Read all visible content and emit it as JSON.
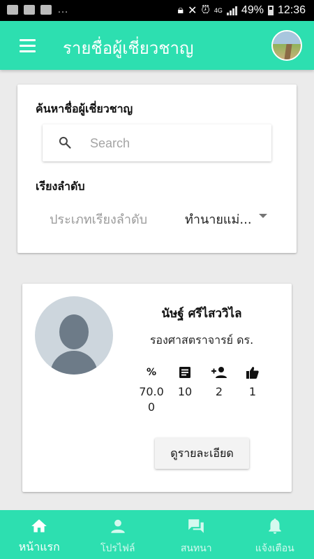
{
  "status_bar": {
    "battery": "49%",
    "time": "12:36",
    "network": "4G"
  },
  "app_bar": {
    "title": "รายชื่อผู้เชี่ยวชาญ",
    "menu_icon": "menu-icon",
    "avatar_icon": "user-photo"
  },
  "search_section": {
    "label": "ค้นหาชื่อผู้เชี่ยวชาญ",
    "search_icon": "search-icon",
    "search_placeholder": "Search",
    "search_value": ""
  },
  "sort_section": {
    "label": "เรียงลำดับ",
    "placeholder": "ประเภทเรียงลำดับ",
    "selected": "ทำนายแม่...",
    "dropdown_icon": "caret-down-icon"
  },
  "expert": {
    "name": "นัษฐ์ ศรีไสววิไล",
    "title": "รองศาสตราจารย์ ดร.",
    "stats": [
      {
        "icon": "percent-icon",
        "symbol": "%",
        "value": "70.00"
      },
      {
        "icon": "article-icon",
        "value": "10"
      },
      {
        "icon": "person-add-icon",
        "value": "2"
      },
      {
        "icon": "thumb-up-icon",
        "value": "1"
      }
    ],
    "detail_button": "ดูรายละเอียด"
  },
  "bottom_nav": {
    "items": [
      {
        "label": "หน้าแรก",
        "icon": "home-icon",
        "active": true
      },
      {
        "label": "โปรไฟล์",
        "icon": "person-icon",
        "active": false
      },
      {
        "label": "สนทนา",
        "icon": "chat-icon",
        "active": false
      },
      {
        "label": "แจ้งเตือน",
        "icon": "bell-icon",
        "active": false
      }
    ]
  },
  "colors": {
    "primary": "#2DDFB0",
    "background": "#EBEBEB",
    "avatar_bg": "#CDD6DD"
  }
}
